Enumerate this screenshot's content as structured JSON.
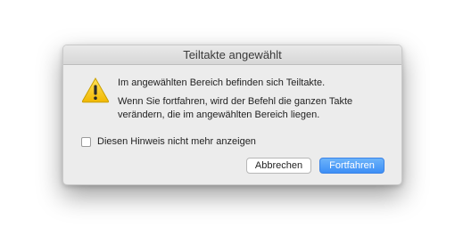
{
  "dialog": {
    "title": "Teiltakte angewählt",
    "icon": "warning-triangle-icon",
    "message_primary": "Im angewählten Bereich befinden sich Teiltakte.",
    "message_secondary": "Wenn Sie fortfahren, wird der Befehl die ganzen Takte verändern, die im angewählten Bereich liegen.",
    "checkbox": {
      "label": "Diesen Hinweis nicht mehr anzeigen",
      "checked": false
    },
    "buttons": {
      "cancel_label": "Abbrechen",
      "continue_label": "Fortfahren"
    }
  },
  "colors": {
    "accent": "#3d8ff6",
    "warning": "#f5c400",
    "dialog_bg": "#ececec"
  }
}
